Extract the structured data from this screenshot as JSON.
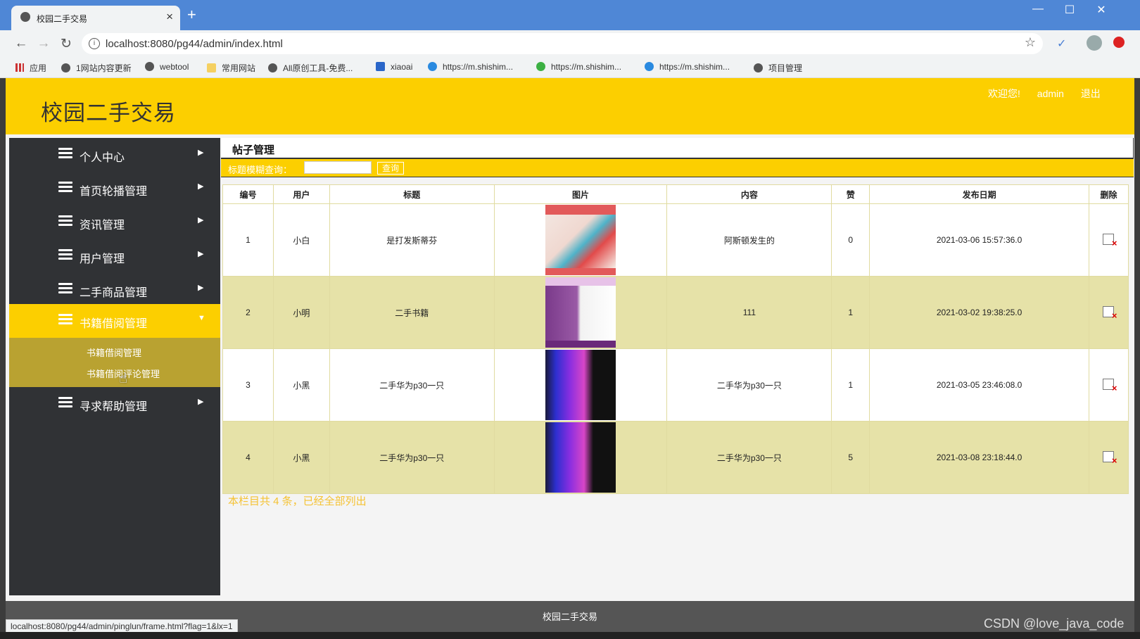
{
  "browser": {
    "tab_title": "校园二手交易",
    "url": "localhost:8080/pg44/admin/index.html",
    "new_tab": "+",
    "bookmarks": [
      "应用",
      "1网站内容更新",
      "webtool",
      "常用网站",
      "All原创工具-免费...",
      "xiaoai",
      "https://m.shishim...",
      "https://m.shishim...",
      "https://m.shishim...",
      "项目管理"
    ],
    "status_url": "localhost:8080/pg44/admin/pinglun/frame.html?flag=1&lx=1"
  },
  "header": {
    "site_title": "校园二手交易",
    "welcome": "欢迎您!",
    "username": "admin",
    "logout": "退出"
  },
  "sidebar": {
    "items": [
      {
        "label": "个人中心"
      },
      {
        "label": "首页轮播管理"
      },
      {
        "label": "资讯管理"
      },
      {
        "label": "用户管理"
      },
      {
        "label": "二手商品管理"
      },
      {
        "label": "书籍借阅管理"
      },
      {
        "label": "寻求帮助管理"
      }
    ],
    "active_index": 5,
    "submenu": [
      "书籍借阅管理",
      "书籍借阅评论管理"
    ]
  },
  "content": {
    "title": "帖子管理",
    "search_label": "标题模糊查询：",
    "search_button": "查询",
    "columns": [
      "编号",
      "用户",
      "标题",
      "图片",
      "内容",
      "赞",
      "发布日期",
      "删除"
    ],
    "rows": [
      {
        "id": "1",
        "user": "小白",
        "title": "是打发斯蒂芬",
        "image": "toy-product-image",
        "content": "阿斯顿发生的",
        "likes": "0",
        "date": "2021-03-06 15:57:36.0"
      },
      {
        "id": "2",
        "user": "小明",
        "title": "二手书籍",
        "image": "python-book-image",
        "content": "111",
        "likes": "1",
        "date": "2021-03-02 19:38:25.0"
      },
      {
        "id": "3",
        "user": "小黑",
        "title": "二手华为p30一只",
        "image": "phone-image",
        "content": "二手华为p30一只",
        "likes": "1",
        "date": "2021-03-05 23:46:08.0"
      },
      {
        "id": "4",
        "user": "小黑",
        "title": "二手华为p30一只",
        "image": "phone-image",
        "content": "二手华为p30一只",
        "likes": "5",
        "date": "2021-03-08 23:18:44.0"
      }
    ],
    "summary": "本栏目共 4 条，已经全部列出"
  },
  "footer": {
    "text": "校园二手交易",
    "watermark": "CSDN @love_java_code"
  },
  "colors": {
    "accent": "#fccf00",
    "sidebar": "#303235",
    "submenu": "#b9a231",
    "row_alt": "#e6e2a8"
  }
}
